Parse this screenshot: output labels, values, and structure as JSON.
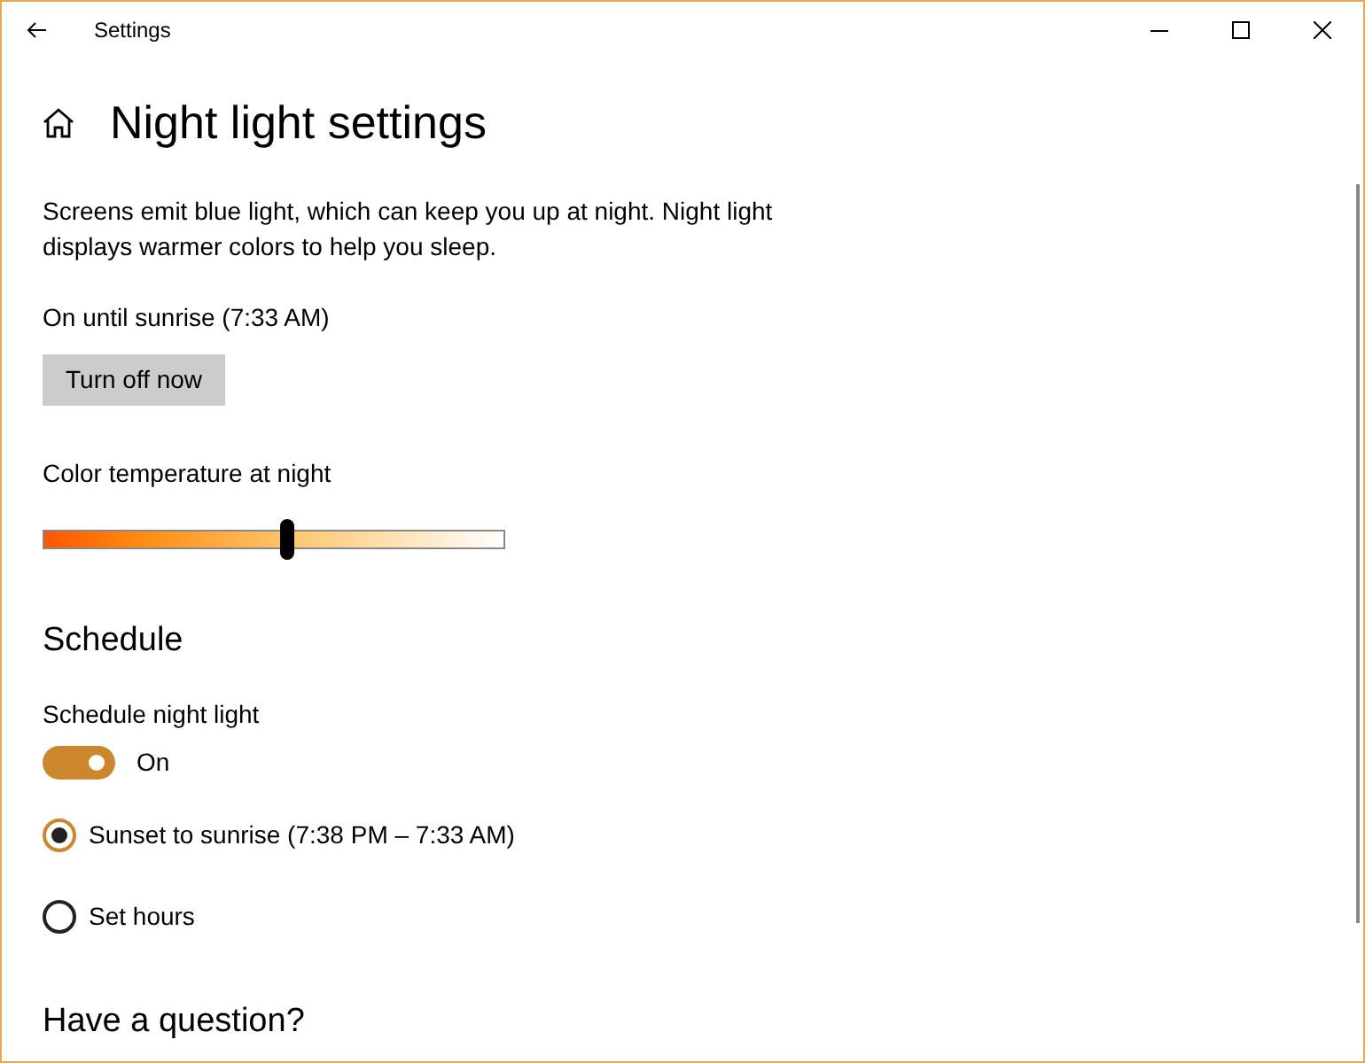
{
  "window": {
    "title": "Settings"
  },
  "page": {
    "title": "Night light settings"
  },
  "description": "Screens emit blue light, which can keep you up at night. Night light displays warmer colors to help you sleep.",
  "status": "On until sunrise (7:33 AM)",
  "turn_off_button": "Turn off now",
  "color_temperature": {
    "label": "Color temperature at night",
    "level": 0.53
  },
  "schedule": {
    "heading": "Schedule",
    "toggle_label": "Schedule night light",
    "on": true,
    "state_text": "On",
    "options": [
      {
        "label": "Sunset to sunrise (7:38 PM – 7:33 AM)",
        "selected": true
      },
      {
        "label": "Set hours",
        "selected": false
      }
    ]
  },
  "help": {
    "heading": "Have a question?"
  }
}
